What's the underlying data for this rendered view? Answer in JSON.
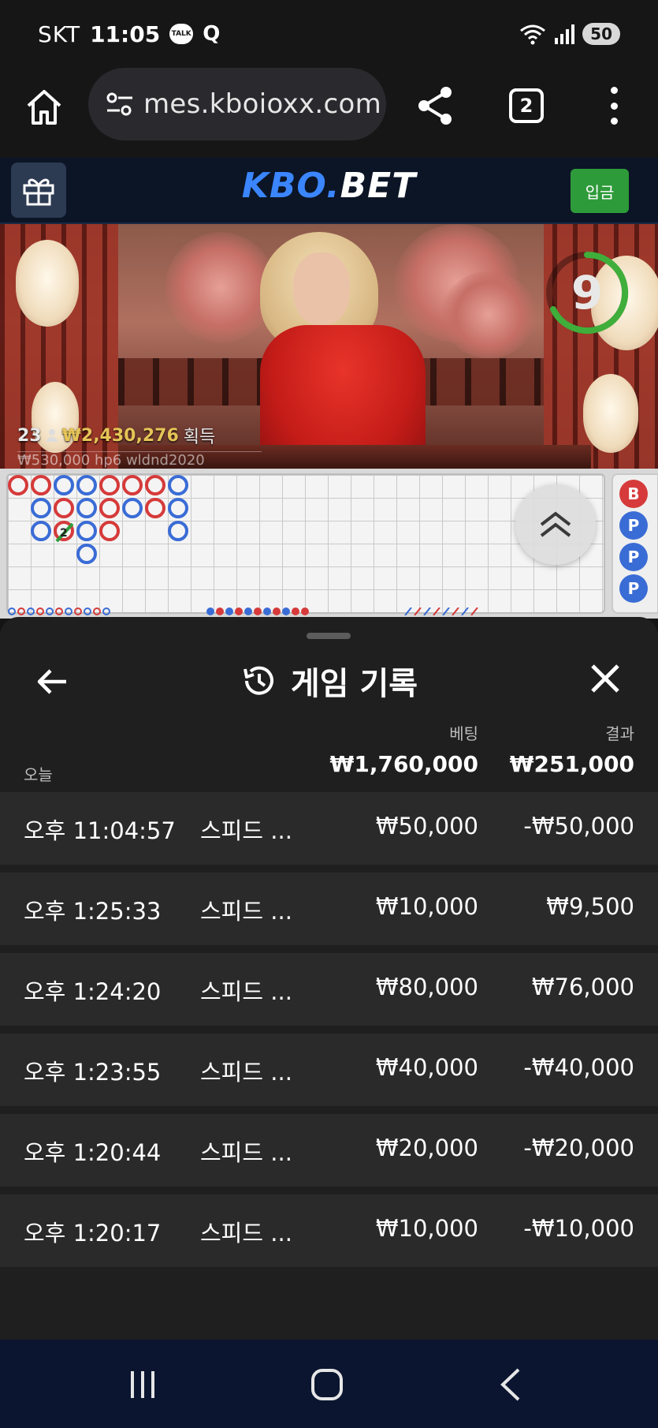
{
  "status_bar": {
    "carrier": "SKT",
    "time": "11:05",
    "talk_badge": "TALK",
    "battery": "50"
  },
  "browser": {
    "url": "mes.kboioxx.com",
    "tab_count": "2"
  },
  "site": {
    "logo_kbo": "KBO",
    "logo_dot": ".",
    "logo_bet": "BET",
    "deposit_label": "입금"
  },
  "video": {
    "countdown": "9",
    "winner_count": "23",
    "winner_amount": "₩2,430,276",
    "winner_suffix": "획득",
    "ticker": "₩530,000 hp6 wldnd2020"
  },
  "roadmap": {
    "tie_marker": "2",
    "side_chips": [
      "B",
      "P",
      "P",
      "P"
    ]
  },
  "history_sheet": {
    "title": "게임 기록",
    "col_bet": "베팅",
    "col_result": "결과",
    "today_label": "오늘",
    "total_bet": "₩1,760,000",
    "total_result": "₩251,000",
    "rows": [
      {
        "time": "오후 11:04:57",
        "game": "스피드 ...",
        "bet": "₩50,000",
        "result": "-₩50,000"
      },
      {
        "time": "오후 1:25:33",
        "game": "스피드 ...",
        "bet": "₩10,000",
        "result": "₩9,500"
      },
      {
        "time": "오후 1:24:20",
        "game": "스피드 ...",
        "bet": "₩80,000",
        "result": "₩76,000"
      },
      {
        "time": "오후 1:23:55",
        "game": "스피드 ...",
        "bet": "₩40,000",
        "result": "-₩40,000"
      },
      {
        "time": "오후 1:20:44",
        "game": "스피드 ...",
        "bet": "₩20,000",
        "result": "-₩20,000"
      },
      {
        "time": "오후 1:20:17",
        "game": "스피드 ...",
        "bet": "₩10,000",
        "result": "-₩10,000"
      }
    ]
  },
  "colors": {
    "banker_red": "#d63a3a",
    "player_blue": "#3a6cd6",
    "deposit_green": "#2e9b3a",
    "logo_blue": "#3b86ff",
    "timer_green": "#3fae3a"
  }
}
